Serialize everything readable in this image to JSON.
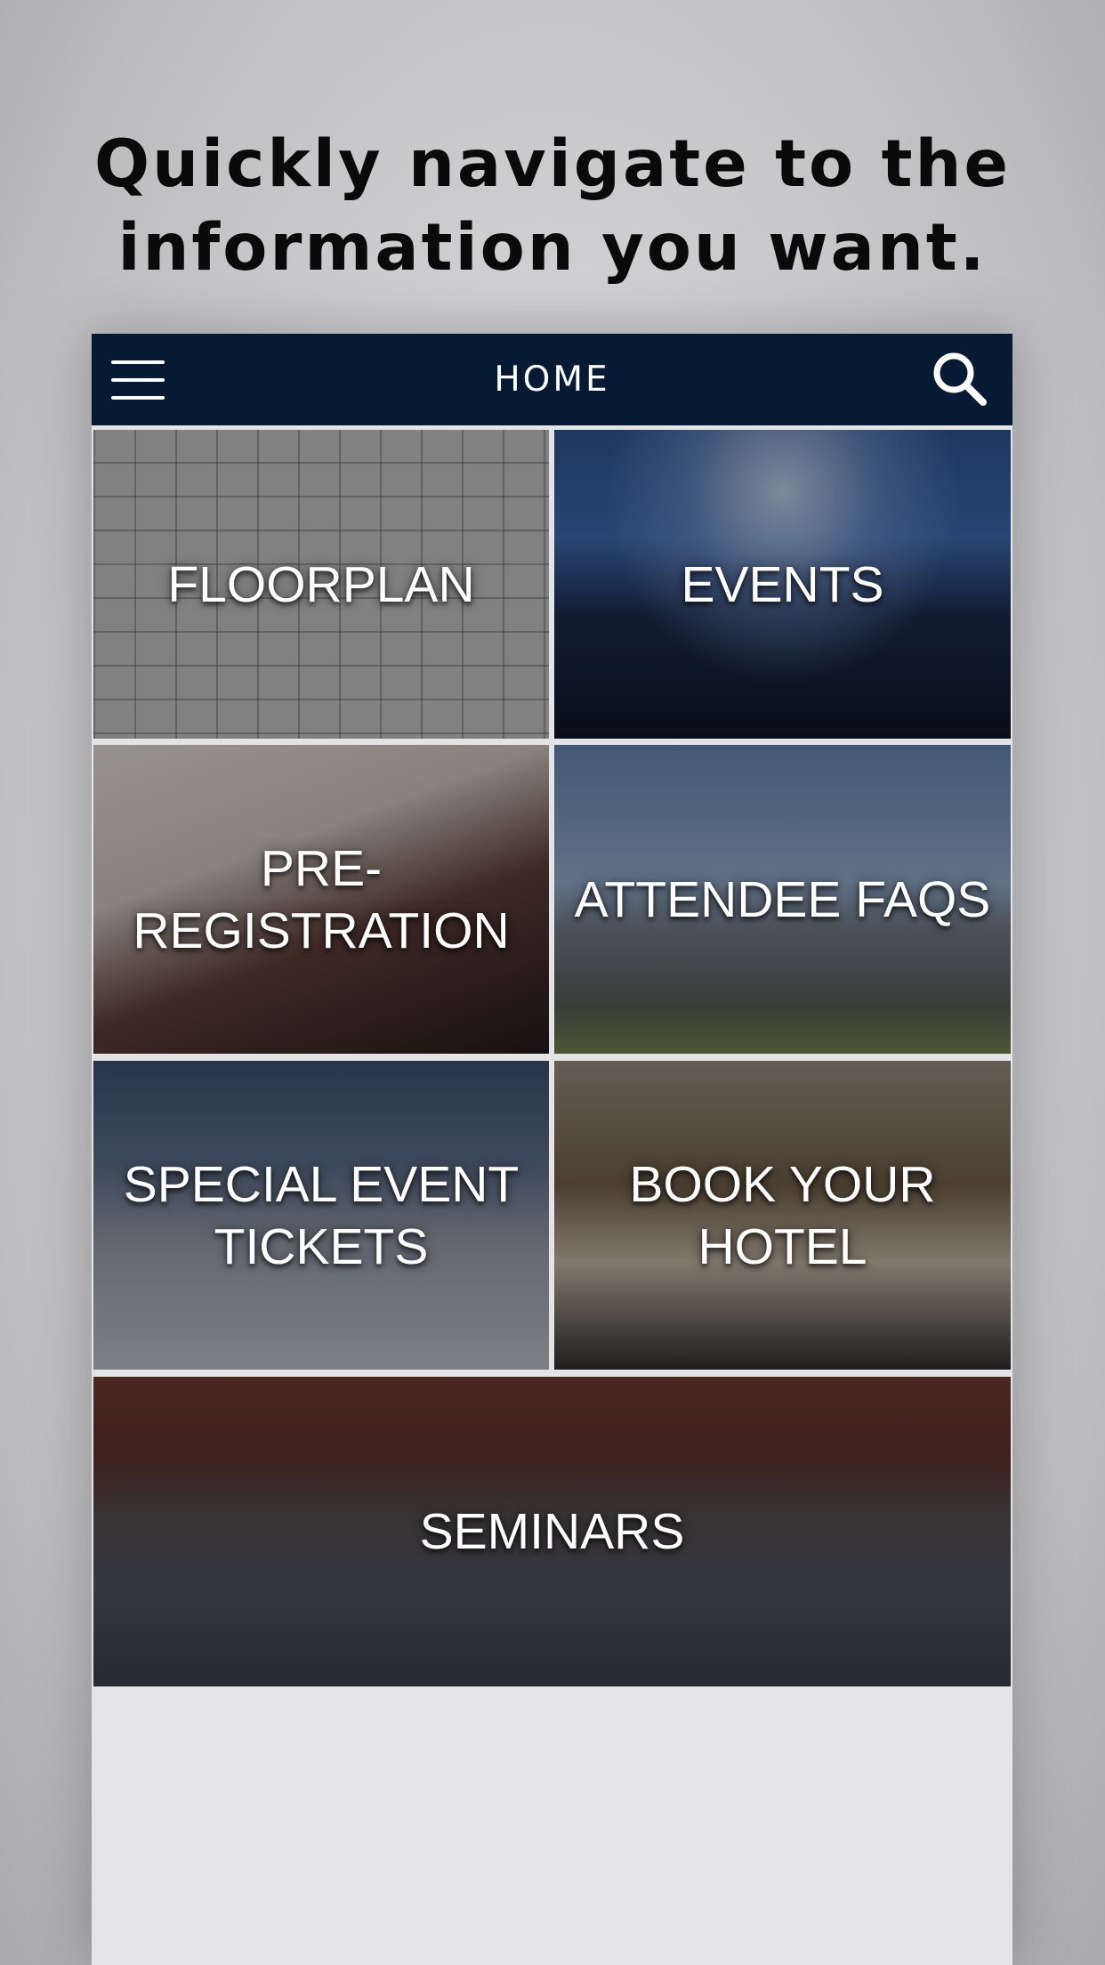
{
  "headline": {
    "line1": "Quickly navigate to the",
    "line2": "information you want."
  },
  "navbar": {
    "title": "HOME",
    "menu_icon": "hamburger-menu-icon",
    "search_icon": "search-icon",
    "background": "#061a33"
  },
  "tiles": [
    {
      "id": "floorplan",
      "label": "FLOORPLAN"
    },
    {
      "id": "events",
      "label": "EVENTS"
    },
    {
      "id": "pre-registration",
      "label_line1": "PRE-",
      "label_line2": "REGISTRATION"
    },
    {
      "id": "attendee-faqs",
      "label": "ATTENDEE FAQS"
    },
    {
      "id": "special-event-tickets",
      "label_line1": "SPECIAL EVENT",
      "label_line2": "TICKETS"
    },
    {
      "id": "book-your-hotel",
      "label_line1": "BOOK YOUR",
      "label_line2": "HOTEL"
    },
    {
      "id": "seminars",
      "label": "SEMINARS"
    }
  ]
}
